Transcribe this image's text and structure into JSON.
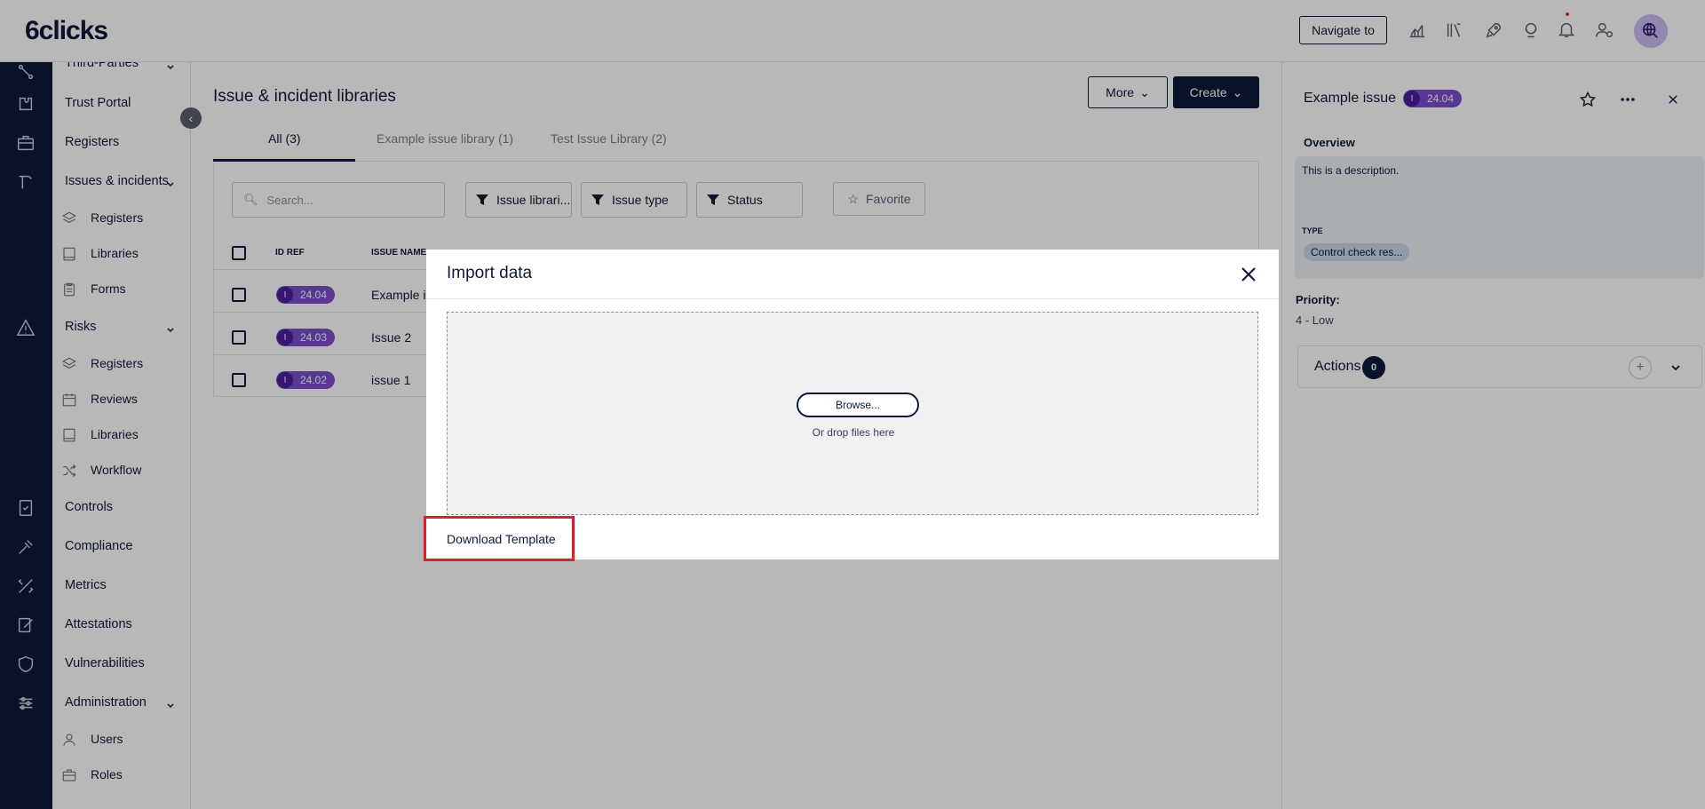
{
  "brand": {
    "logo": "6clicks"
  },
  "topbar": {
    "navigate_to": "Navigate to"
  },
  "sidebar": {
    "items": [
      {
        "label": "Third-Parties"
      },
      {
        "label": "Trust Portal"
      },
      {
        "label": "Registers"
      },
      {
        "label": "Issues & incidents"
      },
      {
        "label": "Registers"
      },
      {
        "label": "Libraries"
      },
      {
        "label": "Forms"
      },
      {
        "label": "Risks"
      },
      {
        "label": "Registers"
      },
      {
        "label": "Reviews"
      },
      {
        "label": "Libraries"
      },
      {
        "label": "Workflow"
      },
      {
        "label": "Controls"
      },
      {
        "label": "Compliance"
      },
      {
        "label": "Metrics"
      },
      {
        "label": "Attestations"
      },
      {
        "label": "Vulnerabilities"
      },
      {
        "label": "Administration"
      },
      {
        "label": "Users"
      },
      {
        "label": "Roles"
      }
    ]
  },
  "main": {
    "title": "Issue & incident libraries",
    "more_label": "More",
    "create_label": "Create",
    "tabs": [
      {
        "label": "All (3)"
      },
      {
        "label": "Example issue library (1)"
      },
      {
        "label": "Test Issue Library (2)"
      }
    ],
    "search_placeholder": "Search...",
    "filters": [
      {
        "label": "Issue librari..."
      },
      {
        "label": "Issue type"
      },
      {
        "label": "Status"
      }
    ],
    "favorite_label": "Favorite",
    "columns": {
      "id_ref": "ID REF",
      "issue_name": "ISSUE NAME"
    },
    "rows": [
      {
        "type": "I",
        "id": "24.04",
        "name": "Example is"
      },
      {
        "type": "I",
        "id": "24.03",
        "name": "Issue 2"
      },
      {
        "type": "I",
        "id": "24.02",
        "name": "issue 1"
      }
    ]
  },
  "detail": {
    "title": "Example issue",
    "badge_type": "I",
    "badge_id": "24.04",
    "overview_label": "Overview",
    "description": "This is a description.",
    "type_label": "TYPE",
    "type_value": "Control check res...",
    "priority_label": "Priority:",
    "priority_value": "4 - Low",
    "actions_label": "Actions",
    "actions_count": "0",
    "plus": "+"
  },
  "modal": {
    "title": "Import data",
    "browse_label": "Browse...",
    "drop_text": "Or drop files here",
    "download_template": "Download Template"
  },
  "colors": {
    "navy": "#0c1a3a",
    "badge_purple": "#7d4ccf",
    "highlight_red": "#e01e2a"
  }
}
